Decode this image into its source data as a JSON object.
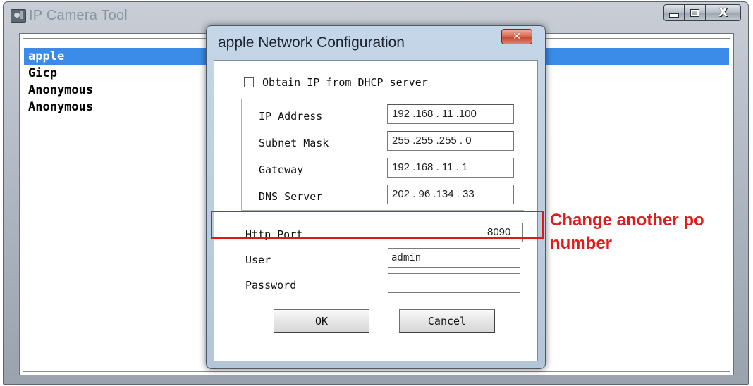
{
  "colors": {
    "selection": "#3b8ce8",
    "annotation_red": "#e21818",
    "dialog_frame": "#c5d6e8"
  },
  "main_window": {
    "title": "IP Camera Tool",
    "icon": "camera-icon",
    "controls": {
      "minimize": "minimize-icon",
      "maximize": "maximize-icon",
      "close_glyph": "X"
    }
  },
  "device_list": {
    "items": [
      {
        "label": "apple",
        "selected": true
      },
      {
        "label": "Gicp",
        "selected": false
      },
      {
        "label": "Anonymous",
        "selected": false
      },
      {
        "label": "Anonymous",
        "selected": false
      }
    ]
  },
  "dialog": {
    "title": "apple Network Configuration",
    "close_glyph": "✕",
    "dhcp_label": "Obtain IP from DHCP server",
    "dhcp_checked": false,
    "fields": [
      {
        "label": "IP Address",
        "value": "192 .168 . 11 .100"
      },
      {
        "label": "Subnet Mask",
        "value": "255 .255 .255 . 0"
      },
      {
        "label": "Gateway",
        "value": "192 .168 . 11 . 1"
      },
      {
        "label": "DNS Server",
        "value": "202 . 96 .134 . 33"
      }
    ],
    "http_port": {
      "label": "Http Port",
      "value": "8090"
    },
    "user": {
      "label": "User",
      "value": "admin"
    },
    "password": {
      "label": "Password",
      "value": ""
    },
    "ok_label": "OK",
    "cancel_label": "Cancel"
  },
  "annotation": {
    "line1": "Change another po",
    "line2": "number"
  }
}
